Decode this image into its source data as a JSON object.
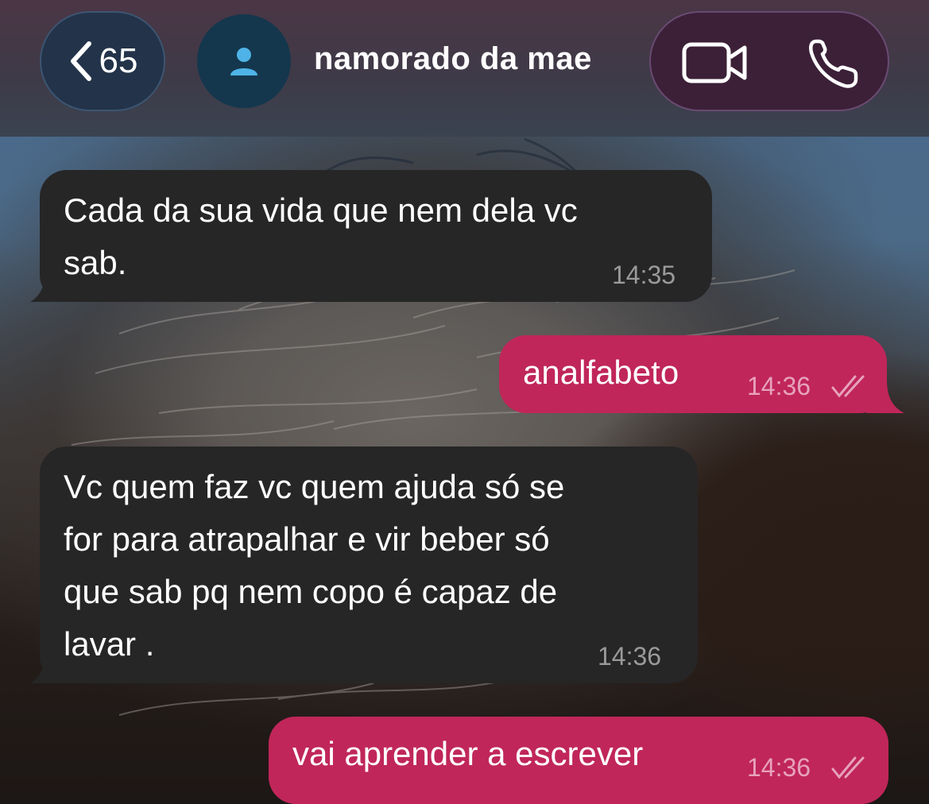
{
  "header": {
    "back_count": "65",
    "contact_name": "namorado da mae",
    "icons": {
      "back": "chevron-left-icon",
      "avatar": "person-icon",
      "video": "video-camera-icon",
      "phone": "phone-icon"
    }
  },
  "messages": [
    {
      "direction": "incoming",
      "text": "Cada da sua vida que nem dela vc\nsab.",
      "time": "14:35"
    },
    {
      "direction": "outgoing",
      "text": "analfabeto",
      "time": "14:36",
      "status": "read"
    },
    {
      "direction": "incoming",
      "text": "Vc quem faz vc quem ajuda só se\nfor para atrapalhar e vir beber só\nque sab pq nem copo é capaz de\nlavar .",
      "time": "14:36"
    },
    {
      "direction": "outgoing",
      "text": "vai aprender a escrever",
      "time": "14:36",
      "status": "read"
    }
  ],
  "colors": {
    "outgoing_bubble": "#c0265a",
    "incoming_bubble": "#262626",
    "header_back_pill": "#233349",
    "avatar_bg": "#14374d",
    "avatar_icon": "#4fb3e8"
  }
}
